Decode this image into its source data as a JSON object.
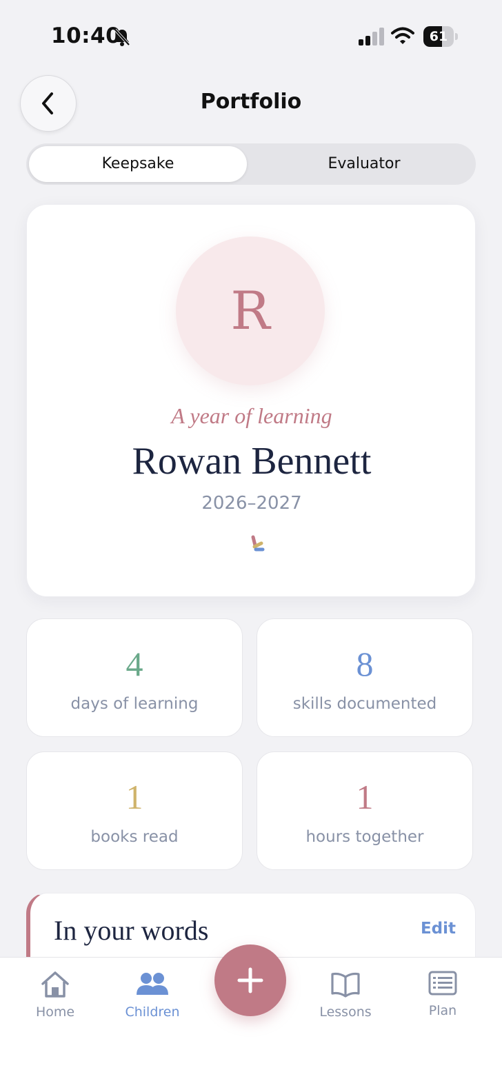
{
  "status_bar": {
    "time": "10:40",
    "battery": "61",
    "battery_level": 0.61,
    "icons": [
      "bell-slash-icon",
      "signal-icon",
      "wifi-icon",
      "battery-icon"
    ]
  },
  "header": {
    "title": "Portfolio",
    "back_icon": "chevron-left-icon"
  },
  "segmented": {
    "options": [
      "Keepsake",
      "Evaluator"
    ],
    "selected": "Keepsake"
  },
  "hero": {
    "initial": "R",
    "subtitle": "A year of learning",
    "name": "Rowan Bennett",
    "years": "2026–2027"
  },
  "stats": [
    {
      "value": "4",
      "label": "days of learning",
      "color": "#6aa98a"
    },
    {
      "value": "8",
      "label": "skills documented",
      "color": "#6b91d4"
    },
    {
      "value": "1",
      "label": "books read",
      "color": "#cfb36b"
    },
    {
      "value": "1",
      "label": "hours together",
      "color": "#c07a86"
    }
  ],
  "words": {
    "title": "In your words",
    "edit": "Edit"
  },
  "tab_bar": {
    "items": [
      {
        "label": "Home",
        "icon": "house-icon"
      },
      {
        "label": "Children",
        "icon": "people-icon",
        "active": true
      },
      {
        "label": "Lessons",
        "icon": "open-book-icon"
      },
      {
        "label": "Plan",
        "icon": "list-card-icon"
      }
    ],
    "fab_icon": "plus-icon"
  },
  "colors": {
    "accent_pink": "#c07a86",
    "accent_blue": "#6b91d4",
    "navy": "#1d2540",
    "muted": "#8891a6"
  }
}
